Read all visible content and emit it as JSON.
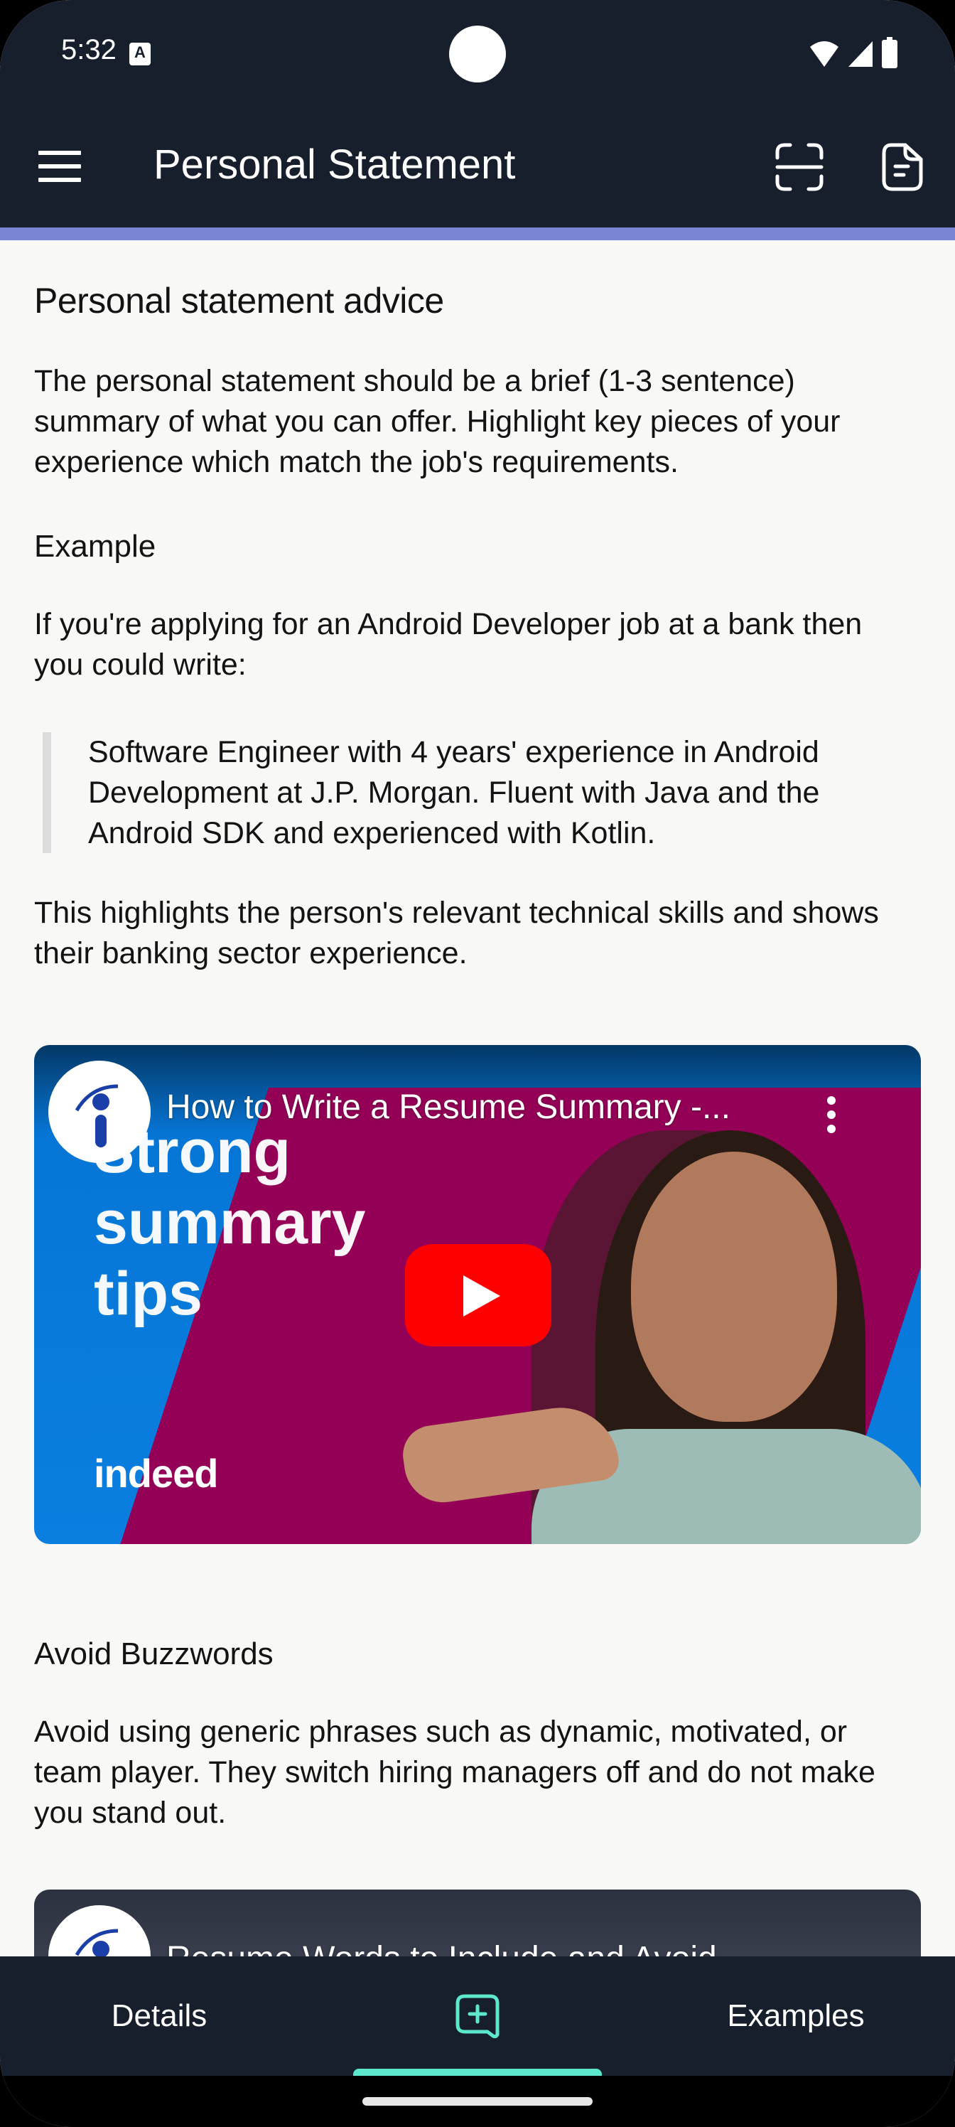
{
  "status_bar": {
    "time": "5:32",
    "notification_icon": "accessibility-a-icon",
    "icons": [
      "wifi-icon",
      "cellular-signal-icon",
      "battery-icon"
    ]
  },
  "app_bar": {
    "title": "Personal Statement",
    "menu_icon": "hamburger-menu-icon",
    "actions": [
      "scan-icon",
      "document-icon"
    ]
  },
  "colors": {
    "app_bar_bg": "#171e2c",
    "accent_strip": "#7986d3",
    "page_bg": "#f8f8f6",
    "nav_accent": "#5ce8cd",
    "quote_border": "#dcdcdc"
  },
  "content": {
    "heading": "Personal statement advice",
    "intro": "The personal statement should be a brief (1-3 sentence) summary of what you can offer. Highlight key pieces of your experience which match the job's requirements.",
    "example_heading": "Example",
    "example_intro": "If you're applying for an Android Developer job at a bank then you could write:",
    "example_quote": "Software Engineer with 4 years' experience in Android Development at J.P. Morgan. Fluent with Java and the Android SDK and experienced with Kotlin.",
    "example_explanation": "This highlights the person's relevant technical skills and shows their banking sector experience.",
    "video1": {
      "title": "How to Write a Resume Summary -...",
      "thumbnail_text": "Strong summary tips",
      "brand": "indeed",
      "channel_icon": "indeed-logo-icon"
    },
    "buzzwords_heading": "Avoid Buzzwords",
    "buzzwords_text": "Avoid using generic phrases such as dynamic, motivated, or team player. They switch hiring managers off and do not make you stand out.",
    "video2": {
      "title": "Resume Words to Include and Avoid...",
      "channel_icon": "indeed-logo-icon"
    }
  },
  "bottom_nav": {
    "items": [
      {
        "label": "Details"
      },
      {
        "label": "",
        "icon": "add-comment-icon",
        "selected": true
      },
      {
        "label": "Examples"
      }
    ]
  }
}
